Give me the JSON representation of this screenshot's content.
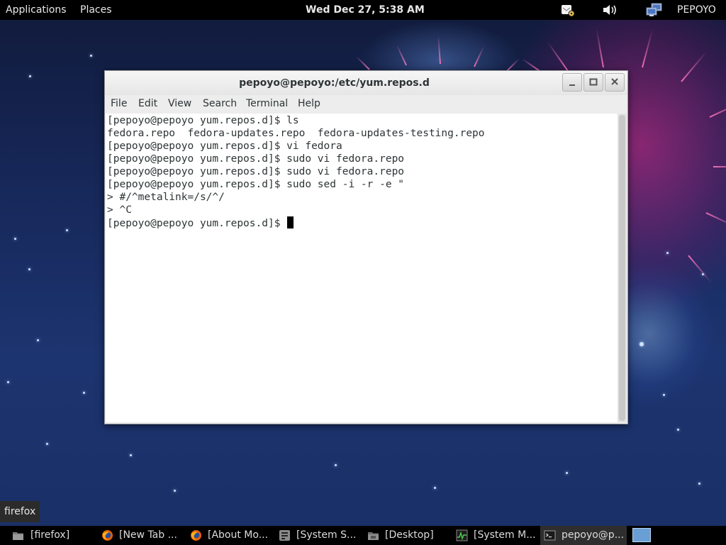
{
  "top_panel": {
    "applications": "Applications",
    "places": "Places",
    "clock": "Wed Dec 27,  5:38 AM",
    "user": "PEPOYO",
    "tray_icons": [
      "notification-icon",
      "volume-icon",
      "network-icon"
    ]
  },
  "window": {
    "title": "pepoyo@pepoyo:/etc/yum.repos.d",
    "menu": [
      "File",
      "Edit",
      "View",
      "Search",
      "Terminal",
      "Help"
    ],
    "terminal_lines": [
      "[pepoyo@pepoyo yum.repos.d]$ ls",
      "fedora.repo  fedora-updates.repo  fedora-updates-testing.repo",
      "[pepoyo@pepoyo yum.repos.d]$ vi fedora",
      "[pepoyo@pepoyo yum.repos.d]$ sudo vi fedora.repo",
      "[pepoyo@pepoyo yum.repos.d]$ sudo vi fedora.repo",
      "[pepoyo@pepoyo yum.repos.d]$ sudo sed -i -r -e \"",
      "> #/^metalink=/s/^/",
      "> ^C",
      "[pepoyo@pepoyo yum.repos.d]$ "
    ]
  },
  "tooltip": "firefox",
  "taskbar": {
    "items": [
      {
        "label": "[firefox]",
        "icon": "folder-icon"
      },
      {
        "label": "[New Tab ...",
        "icon": "firefox-icon"
      },
      {
        "label": "[About Mo...",
        "icon": "firefox-icon"
      },
      {
        "label": "[System S...",
        "icon": "settings-icon"
      },
      {
        "label": "[Desktop]",
        "icon": "folder-icon"
      },
      {
        "label": "[System M...",
        "icon": "system-monitor-icon"
      },
      {
        "label": "pepoyo@p...",
        "icon": "terminal-icon"
      }
    ]
  },
  "colors": {
    "panel": "#000000",
    "terminal_bg": "#ffffff",
    "terminal_fg": "#2e3436",
    "workspace_active": "#6a9fd6"
  }
}
